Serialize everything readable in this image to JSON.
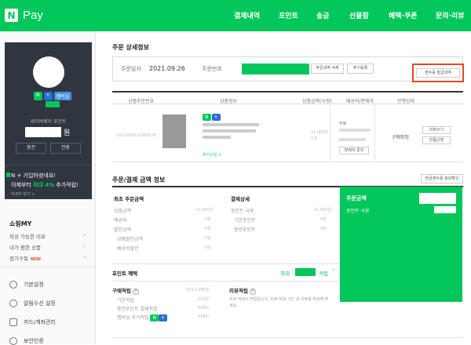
{
  "header": {
    "logo_letter": "N",
    "logo_text": "Pay",
    "nav": [
      "결제내역",
      "포인트",
      "송금",
      "선물함",
      "혜택·쿠폰",
      "문의·리뷰"
    ]
  },
  "sidebar": {
    "badges": [
      "N",
      "+",
      "멤버십"
    ],
    "point_label": "네이버페이 포인트",
    "point_unit": "원",
    "buttons": [
      "충전",
      "전환"
    ],
    "promo": {
      "line1": "N + 가입하셨네요!",
      "line2_prefix": "이제부터 ",
      "line2_highlight": "최대 4%",
      "line2_suffix": " 추가적립!",
      "line3": "자세히 보기 >"
    },
    "shop_title": "쇼핑MY",
    "shop_items": [
      "작성 가능한 리뷰",
      "내가 찜한 상품",
      "정기구독"
    ],
    "new_tag": "NEW",
    "menu": [
      "기본설정",
      "알림수신 설정",
      "카드/계좌관리",
      "보안인증"
    ]
  },
  "order_detail": {
    "title": "주문 상세정보",
    "date_label": "주문일자",
    "date_value": "2021.09.26",
    "order_no_label": "주문번호",
    "buttons": [
      "주문내역 삭제",
      "후기등록"
    ],
    "receipt_button": "영수증 발급내역"
  },
  "table": {
    "headers": [
      "상품주문번호",
      "상품정보",
      "상품금액(수량)",
      "배송비/판매자",
      "진행상태"
    ],
    "status": "구매확정",
    "option_text": "추가구성 >",
    "ship_label": "무료",
    "ship_buttons": [
      "판매자 문의"
    ],
    "status_buttons": [
      "리뷰쓰기",
      "반품신청"
    ]
  },
  "payment": {
    "title": "주문/결제 금액 정보",
    "receipt_button": "현금영수증 정보확인",
    "left_head": "최초 주문금액",
    "left_items": [
      "상품금액",
      "배송비",
      "할인금액",
      "상품할인금액",
      "배송비할인"
    ],
    "mid_head": "결제상세",
    "mid_items": [
      "포인트 사용",
      "기본포인트",
      "충전포인트"
    ],
    "green_head": "주문금액",
    "green_sub": "포인트 사용"
  },
  "benefit": {
    "title": "포인트 혜택",
    "max_label": "최대",
    "max_suffix": "적립",
    "purchase_label": "구매적립",
    "review_label": "리뷰적립",
    "purchase_items": [
      "기본적립",
      "충전포인트 결제적립",
      "멤버십 추가적립"
    ],
    "review_note": "리뷰 작성시 적립됩니다. 리뷰 작성 기간 내 리뷰를 작성해 주세요."
  }
}
